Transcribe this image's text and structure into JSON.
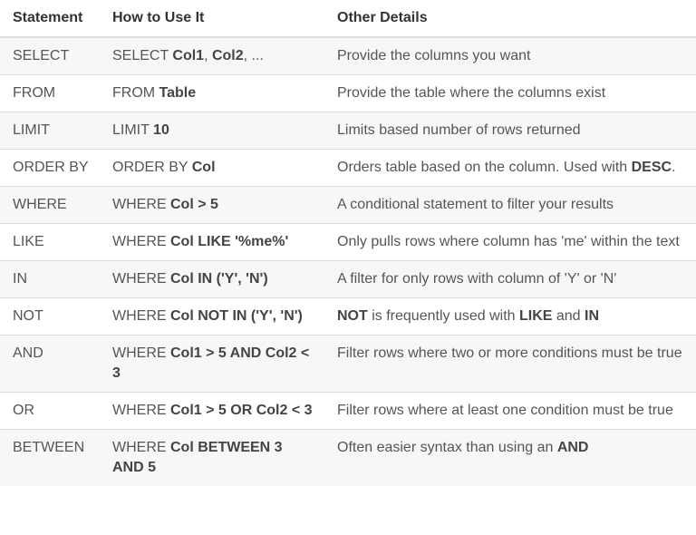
{
  "headers": [
    "Statement",
    "How to Use It",
    "Other Details"
  ],
  "rows": [
    {
      "statement": "SELECT",
      "usage": [
        {
          "t": "SELECT ",
          "b": false
        },
        {
          "t": "Col1",
          "b": true
        },
        {
          "t": ", ",
          "b": false
        },
        {
          "t": "Col2",
          "b": true
        },
        {
          "t": ", ...",
          "b": false
        }
      ],
      "details": [
        {
          "t": "Provide the columns you want",
          "b": false
        }
      ]
    },
    {
      "statement": "FROM",
      "usage": [
        {
          "t": "FROM ",
          "b": false
        },
        {
          "t": "Table",
          "b": true
        }
      ],
      "details": [
        {
          "t": "Provide the table where the columns exist",
          "b": false
        }
      ]
    },
    {
      "statement": "LIMIT",
      "usage": [
        {
          "t": "LIMIT ",
          "b": false
        },
        {
          "t": "10",
          "b": true
        }
      ],
      "details": [
        {
          "t": "Limits based number of rows returned",
          "b": false
        }
      ]
    },
    {
      "statement": "ORDER BY",
      "usage": [
        {
          "t": "ORDER BY ",
          "b": false
        },
        {
          "t": "Col",
          "b": true
        }
      ],
      "details": [
        {
          "t": "Orders table based on the column. Used with ",
          "b": false
        },
        {
          "t": "DESC",
          "b": true
        },
        {
          "t": ".",
          "b": false
        }
      ]
    },
    {
      "statement": "WHERE",
      "usage": [
        {
          "t": "WHERE ",
          "b": false
        },
        {
          "t": "Col > 5",
          "b": true
        }
      ],
      "details": [
        {
          "t": "A conditional statement to filter your results",
          "b": false
        }
      ]
    },
    {
      "statement": "LIKE",
      "usage": [
        {
          "t": "WHERE ",
          "b": false
        },
        {
          "t": "Col LIKE '%me%'",
          "b": true
        }
      ],
      "details": [
        {
          "t": "Only pulls rows where column has 'me' within the text",
          "b": false
        }
      ]
    },
    {
      "statement": "IN",
      "usage": [
        {
          "t": "WHERE ",
          "b": false
        },
        {
          "t": "Col IN ('Y', 'N')",
          "b": true
        }
      ],
      "details": [
        {
          "t": "A filter for only rows with column of 'Y' or 'N'",
          "b": false
        }
      ]
    },
    {
      "statement": "NOT",
      "usage": [
        {
          "t": "WHERE ",
          "b": false
        },
        {
          "t": "Col NOT IN ('Y', 'N')",
          "b": true
        }
      ],
      "details": [
        {
          "t": "NOT",
          "b": true
        },
        {
          "t": " is frequently used with ",
          "b": false
        },
        {
          "t": "LIKE",
          "b": true
        },
        {
          "t": " and ",
          "b": false
        },
        {
          "t": "IN",
          "b": true
        }
      ]
    },
    {
      "statement": "AND",
      "usage": [
        {
          "t": "WHERE ",
          "b": false
        },
        {
          "t": "Col1 > 5 AND Col2 < 3",
          "b": true
        }
      ],
      "details": [
        {
          "t": "Filter rows where two or more conditions must be true",
          "b": false
        }
      ]
    },
    {
      "statement": "OR",
      "usage": [
        {
          "t": "WHERE ",
          "b": false
        },
        {
          "t": "Col1 > 5 OR Col2 < 3",
          "b": true
        }
      ],
      "details": [
        {
          "t": "Filter rows where at least one condition must be true",
          "b": false
        }
      ]
    },
    {
      "statement": "BETWEEN",
      "usage": [
        {
          "t": "WHERE ",
          "b": false
        },
        {
          "t": "Col BETWEEN 3 AND 5",
          "b": true
        }
      ],
      "details": [
        {
          "t": "Often easier syntax than using an ",
          "b": false
        },
        {
          "t": "AND",
          "b": true
        }
      ]
    }
  ]
}
